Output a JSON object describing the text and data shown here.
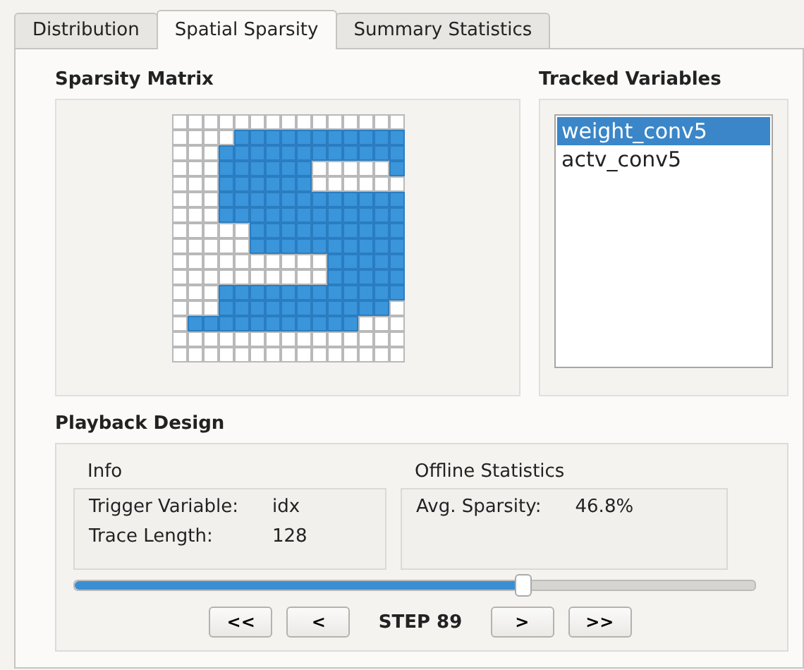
{
  "tabs": [
    {
      "label": "Distribution",
      "selected": false
    },
    {
      "label": "Spatial Sparsity",
      "selected": true
    },
    {
      "label": "Summary Statistics",
      "selected": false
    }
  ],
  "sparsity_matrix": {
    "title": "Sparsity Matrix",
    "rows": [
      [
        false,
        false,
        false,
        false,
        false,
        false,
        false,
        false,
        false,
        false,
        false,
        false,
        false,
        false,
        false
      ],
      [
        false,
        false,
        false,
        false,
        true,
        true,
        true,
        true,
        true,
        true,
        true,
        true,
        true,
        true,
        true
      ],
      [
        false,
        false,
        false,
        true,
        true,
        true,
        true,
        true,
        true,
        true,
        true,
        true,
        true,
        true,
        true
      ],
      [
        false,
        false,
        false,
        true,
        true,
        true,
        true,
        true,
        true,
        false,
        false,
        false,
        false,
        false,
        true
      ],
      [
        false,
        false,
        false,
        true,
        true,
        true,
        true,
        true,
        true,
        false,
        false,
        false,
        false,
        false,
        false
      ],
      [
        false,
        false,
        false,
        true,
        true,
        true,
        true,
        true,
        true,
        true,
        true,
        true,
        true,
        true,
        true
      ],
      [
        false,
        false,
        false,
        true,
        true,
        true,
        true,
        true,
        true,
        true,
        true,
        true,
        true,
        true,
        true
      ],
      [
        false,
        false,
        false,
        false,
        false,
        true,
        true,
        true,
        true,
        true,
        true,
        true,
        true,
        true,
        true
      ],
      [
        false,
        false,
        false,
        false,
        false,
        true,
        true,
        true,
        true,
        true,
        true,
        true,
        true,
        true,
        true
      ],
      [
        false,
        false,
        false,
        false,
        false,
        false,
        false,
        false,
        false,
        false,
        true,
        true,
        true,
        true,
        true
      ],
      [
        false,
        false,
        false,
        false,
        false,
        false,
        false,
        false,
        false,
        false,
        true,
        true,
        true,
        true,
        true
      ],
      [
        false,
        false,
        false,
        true,
        true,
        true,
        true,
        true,
        true,
        true,
        true,
        true,
        true,
        true,
        true
      ],
      [
        false,
        false,
        false,
        true,
        true,
        true,
        true,
        true,
        true,
        true,
        true,
        true,
        true,
        true,
        false
      ],
      [
        false,
        true,
        true,
        true,
        true,
        true,
        true,
        true,
        true,
        true,
        true,
        true,
        false,
        false,
        false
      ],
      [
        false,
        false,
        false,
        false,
        false,
        false,
        false,
        false,
        false,
        false,
        false,
        false,
        false,
        false,
        false
      ],
      [
        false,
        false,
        false,
        false,
        false,
        false,
        false,
        false,
        false,
        false,
        false,
        false,
        false,
        false,
        false
      ]
    ]
  },
  "tracked_variables": {
    "title": "Tracked Variables",
    "items": [
      {
        "label": "weight_conv5",
        "selected": true
      },
      {
        "label": "actv_conv5",
        "selected": false
      }
    ]
  },
  "playback_design": {
    "title": "Playback Design",
    "info": {
      "title": "Info",
      "rows": [
        {
          "label": "Trigger Variable:",
          "value": "idx"
        },
        {
          "label": "Trace Length:",
          "value": "128"
        }
      ]
    },
    "offline_statistics": {
      "title": "Offline Statistics",
      "rows": [
        {
          "label": "Avg. Sparsity:",
          "value": "46.8%"
        }
      ]
    },
    "slider": {
      "level": 0.66
    },
    "buttons": [
      "<<",
      "<"
    ],
    "step": "STEP 89",
    "buttons_after": [
      ">",
      ">>"
    ]
  }
}
